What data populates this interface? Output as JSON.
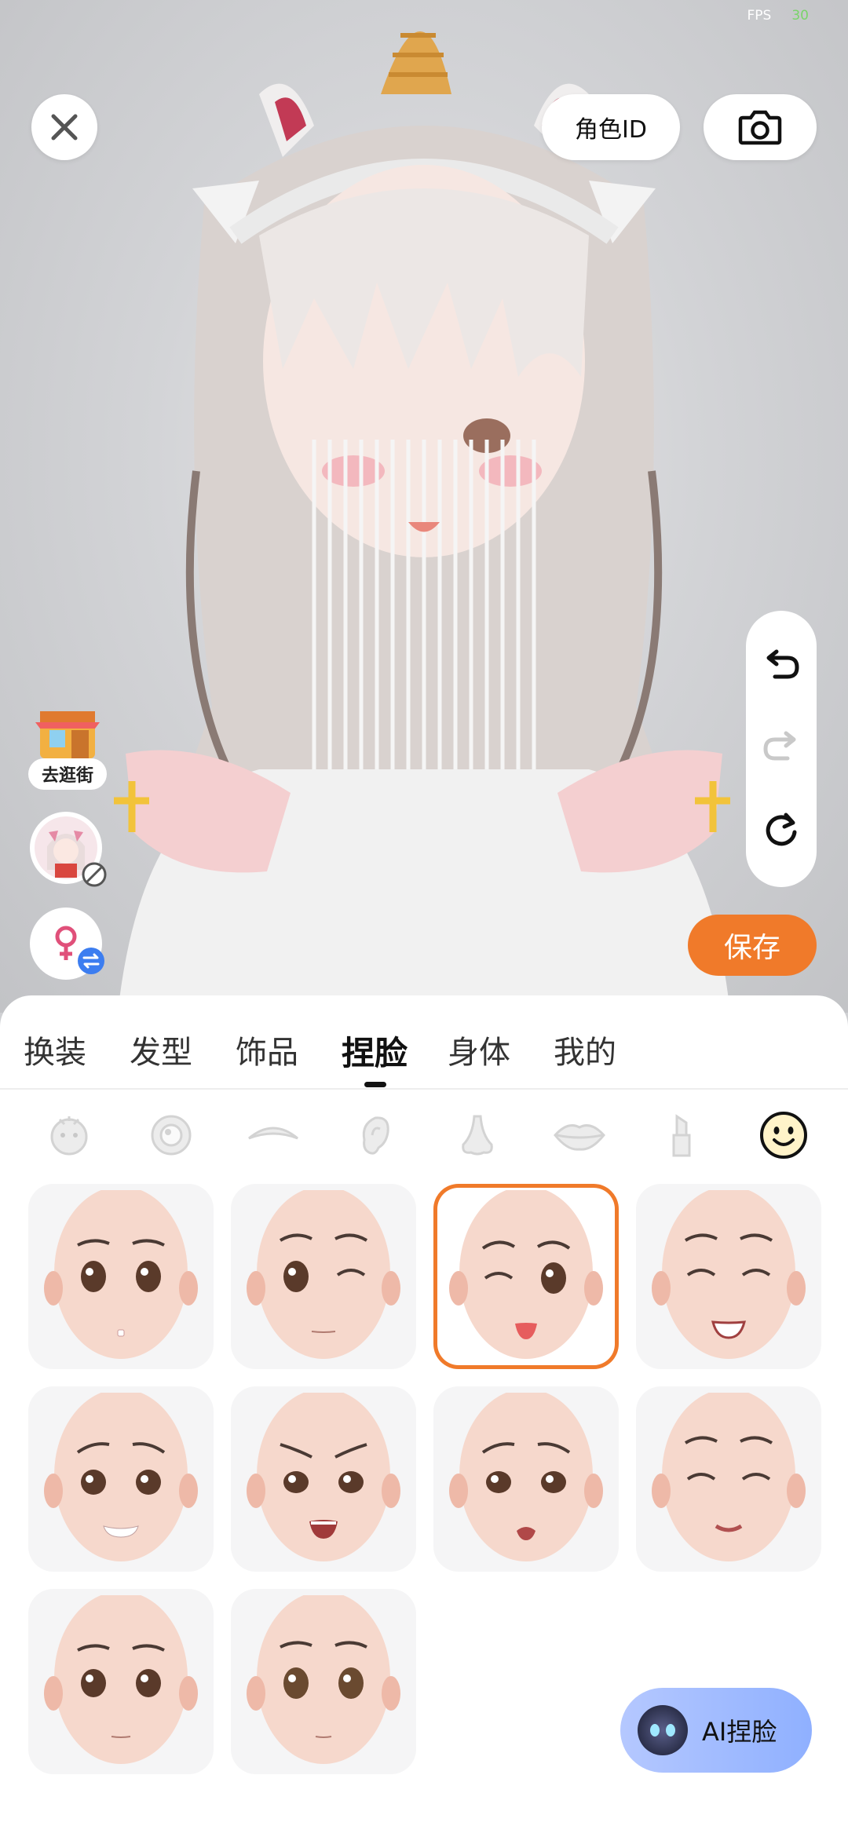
{
  "status": {
    "fps_label": "FPS",
    "fps_value": "30"
  },
  "top_bar": {
    "role_id_label": "角色ID"
  },
  "side": {
    "shop_label": "去逛街"
  },
  "save_label": "保存",
  "tabs": [
    {
      "label": "换装",
      "active": false
    },
    {
      "label": "发型",
      "active": false
    },
    {
      "label": "饰品",
      "active": false
    },
    {
      "label": "捏脸",
      "active": true
    },
    {
      "label": "身体",
      "active": false
    },
    {
      "label": "我的",
      "active": false
    }
  ],
  "subcategories": [
    "face-shape-icon",
    "eye-icon",
    "eyebrow-icon",
    "ear-icon",
    "nose-icon",
    "lips-icon",
    "lipstick-icon",
    "expression-icon"
  ],
  "active_subcategory": "expression-icon",
  "expressions": [
    {
      "name": "neutral-surprised"
    },
    {
      "name": "wink"
    },
    {
      "name": "wink-tongue",
      "selected": true
    },
    {
      "name": "happy-closed-eyes"
    },
    {
      "name": "worried-smile"
    },
    {
      "name": "angry-open-mouth"
    },
    {
      "name": "sad-open-mouth"
    },
    {
      "name": "calm-closed-eyes"
    },
    {
      "name": "neutral-1"
    },
    {
      "name": "neutral-2"
    }
  ],
  "ai_button_label": "AI捏脸",
  "colors": {
    "accent": "#f07a2a",
    "tab_active": "#111111"
  }
}
